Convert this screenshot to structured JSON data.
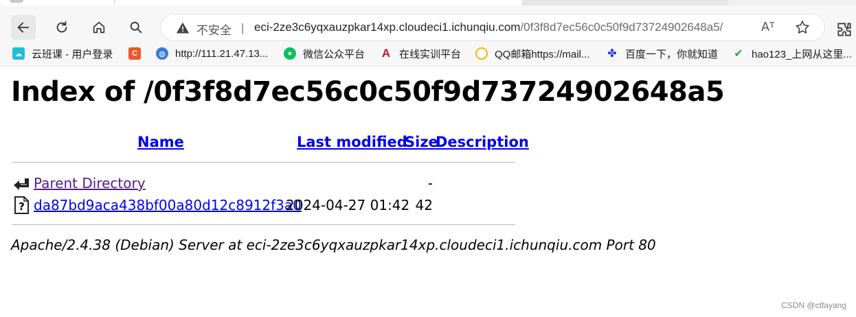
{
  "browser": {
    "security_label": "不安全",
    "separator": "|",
    "url_host": "eci-2ze3c6yqxauzpkar14xp.cloudeci1.ichunqiu.com",
    "url_path": "/0f3f8d7ec56c0c50f9d73724902648a5/",
    "read_aloud_glyph": "Aᵀ"
  },
  "bookmarks": [
    {
      "label": "云班课 - 用户登录",
      "icon": "cloud-class-icon",
      "color": "#1ec0d8"
    },
    {
      "label": "",
      "icon": "c-logo-icon",
      "color": "#f0552b"
    },
    {
      "label": "http://111.21.47.13...",
      "icon": "globe-icon",
      "color": "#3a78d8"
    },
    {
      "label": "微信公众平台",
      "icon": "wechat-icon",
      "color": "#07c160"
    },
    {
      "label": "在线实训平台",
      "icon": "a-logo-icon",
      "color": "#c8102e"
    },
    {
      "label": "QQ邮箱https://mail...",
      "icon": "qq-mail-icon",
      "color": "#f4b400"
    },
    {
      "label": "百度一下，你就知道",
      "icon": "baidu-paw-icon",
      "color": "#2932e1"
    },
    {
      "label": "hao123_上网从这里...",
      "icon": "hao123-icon",
      "color": "#28a745"
    }
  ],
  "page": {
    "title": "Index of /0f3f8d7ec56c0c50f9d73724902648a5",
    "columns": {
      "name": "Name",
      "last_modified": "Last modified",
      "size": "Size",
      "description": "Description"
    },
    "rows": [
      {
        "name": "Parent Directory",
        "last_modified": "",
        "size": "-",
        "icon": "back-arrow-icon"
      },
      {
        "name": "da87bd9aca438bf00a80d12c8912f3a0",
        "last_modified": "2024-04-27 01:42",
        "size": "42",
        "icon": "unknown-file-icon"
      }
    ],
    "server_signature": "Apache/2.4.38 (Debian) Server at eci-2ze3c6yqxauzpkar14xp.cloudeci1.ichunqiu.com Port 80"
  },
  "watermark": "CSDN @ctfayang",
  "colors": {
    "link": "#0000ee",
    "visited_link": "#551a8b",
    "toolbar_bg": "#f7f7f7"
  }
}
